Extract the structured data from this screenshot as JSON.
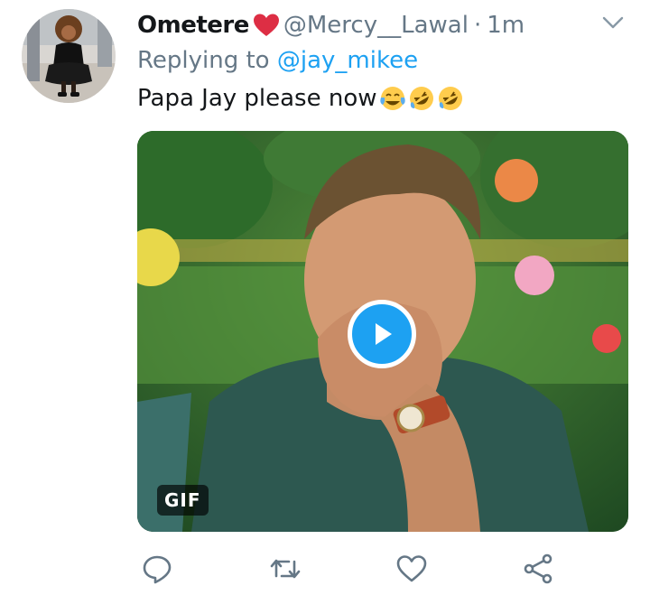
{
  "tweet": {
    "display_name": "Ometere",
    "handle": "@Mercy__Lawal",
    "separator": "·",
    "time": "1m",
    "replying_prefix": "Replying to",
    "replying_to": "@jay_mikee",
    "text": "Papa Jay please now",
    "emojis": [
      "face-with-tears-of-joy",
      "rolling-on-the-floor-laughing",
      "rolling-on-the-floor-laughing"
    ],
    "media": {
      "type": "gif",
      "badge": "GIF"
    }
  },
  "icons": {
    "name_decoration": "red-heart-icon",
    "menu": "chevron-down-icon",
    "play": "play-icon",
    "actions": [
      "reply-icon",
      "retweet-icon",
      "like-icon",
      "share-icon"
    ]
  },
  "colors": {
    "accent": "#1da1f2",
    "secondary_text": "#657786",
    "heart": "#e0245e"
  }
}
